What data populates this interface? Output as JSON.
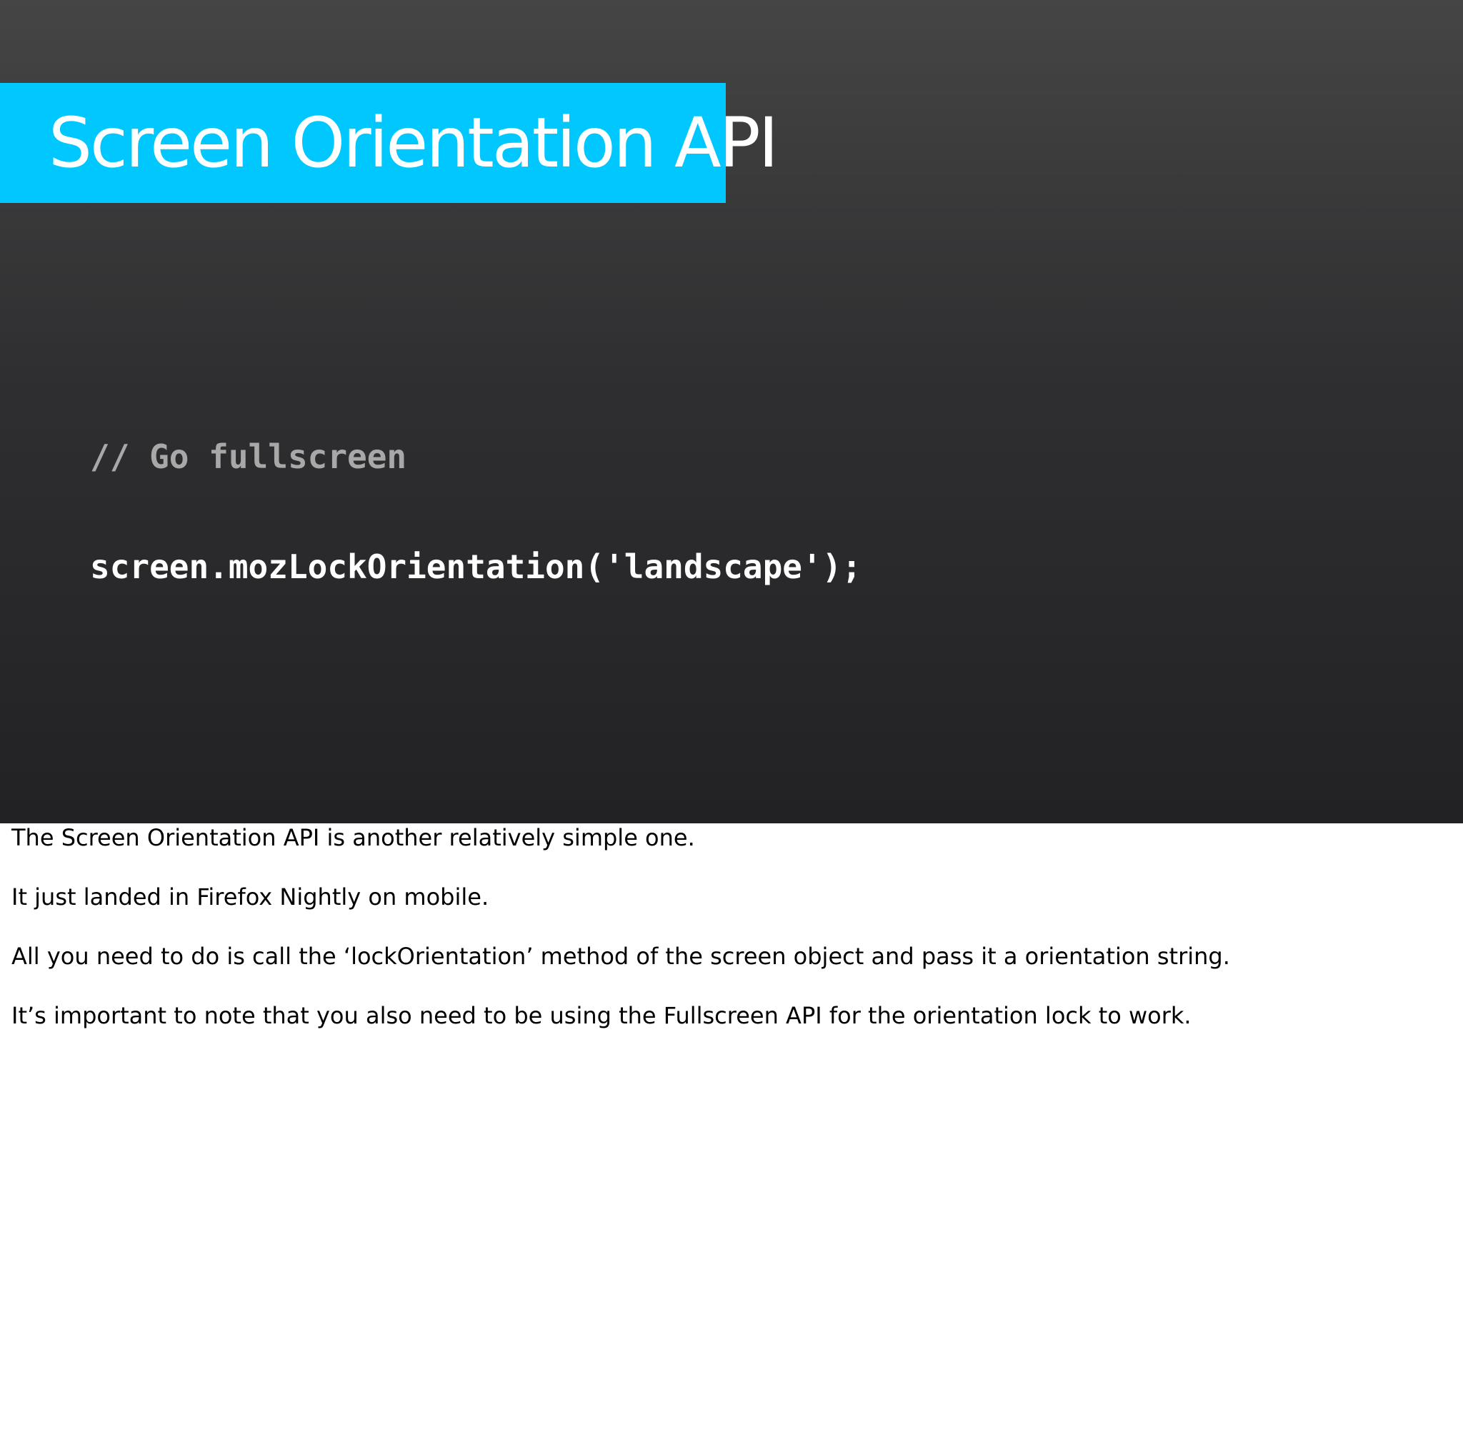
{
  "slide": {
    "title": "Screen Orientation API",
    "code_comment": "// Go fullscreen",
    "code_line": "screen.mozLockOrientation('landscape');"
  },
  "notes": [
    "The Screen Orientation API is another relatively simple one.",
    "It just landed in Firefox Nightly on mobile.",
    "All you need to do is call the ‘lockOrientation’ method of the screen object and pass it a orientation string.",
    "It’s important to note that you also need to be using the Fullscreen API for the orientation lock to work."
  ],
  "colors": {
    "title_band": "#00c8ff",
    "slide_bg_top": "#454545",
    "slide_bg_bottom": "#222124",
    "code_comment": "#a8a8a8",
    "code_text": "#ffffff"
  }
}
